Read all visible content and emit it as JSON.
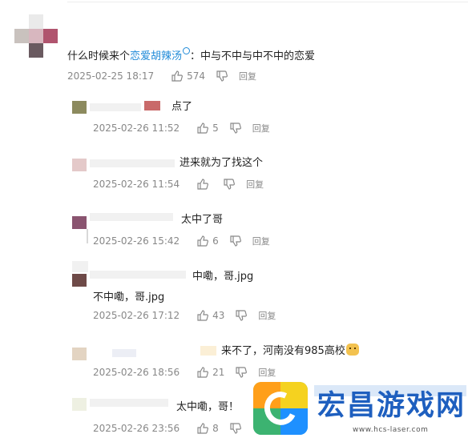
{
  "main_comment": {
    "prefix": "什么时候来个",
    "topic": "恋爱胡辣汤",
    "suffix": "：中与不中与中不中的恋爱",
    "time": "2025-02-25 18:17",
    "likes": "574",
    "reply_label": "回复"
  },
  "replies": [
    {
      "text": "点了",
      "time": "2025-02-26 11:52",
      "likes": "5",
      "reply_label": "回复"
    },
    {
      "text": "进来就为了找这个",
      "time": "2025-02-26 11:54",
      "likes": "",
      "reply_label": "回复"
    },
    {
      "text": "太中了哥",
      "time": "2025-02-26 15:42",
      "likes": "6",
      "reply_label": "回复"
    },
    {
      "text": "中嘞，哥.jpg",
      "text2": "不中嘞，哥.jpg",
      "time": "2025-02-26 17:12",
      "likes": "43",
      "reply_label": "回复"
    },
    {
      "text": "来不了，河南没有985高校",
      "time": "2025-02-26 18:56",
      "likes": "21",
      "reply_label": "回复"
    },
    {
      "text": "太中嘞，哥！",
      "time": "2025-02-26 23:56",
      "likes": "8",
      "reply_label": "回复"
    }
  ],
  "watermark": {
    "title": "宏昌游戏网",
    "url": "www.hcs-laser.com"
  },
  "icons": [
    "thumb-up-icon",
    "thumb-down-icon",
    "magnifier-icon",
    "cat-emoji-icon"
  ]
}
